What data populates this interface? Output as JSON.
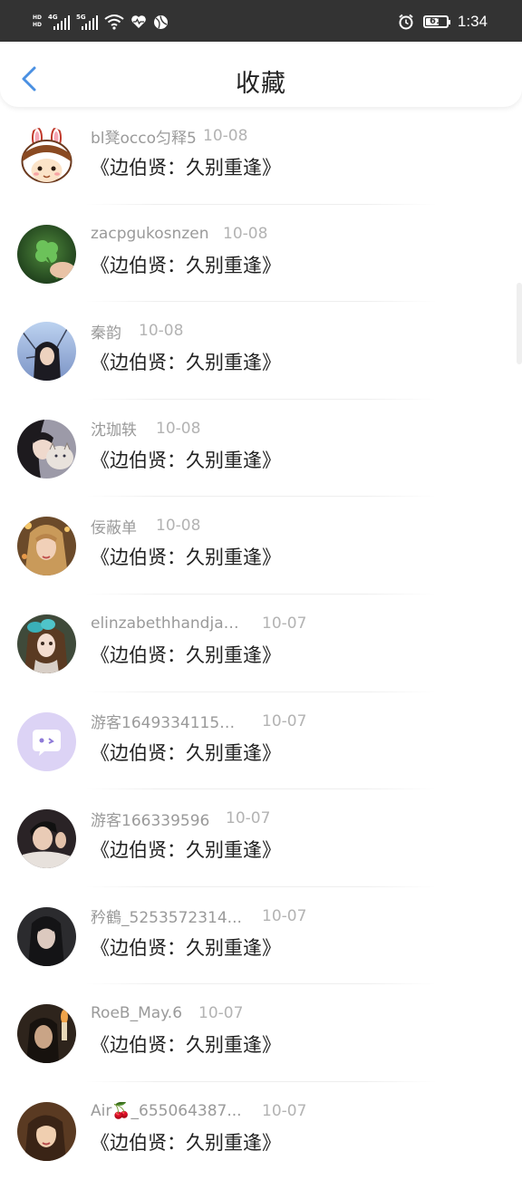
{
  "status_bar": {
    "hd_top": "HD",
    "hd_bottom": "HD",
    "net1": "4G",
    "net2": "5G",
    "battery": "61",
    "time": "1:34"
  },
  "header": {
    "title": "收藏"
  },
  "items": [
    {
      "name": "bl凳occo匀释5",
      "date": "10-08",
      "work": "《边伯贤：久别重逢》",
      "avatar": "bunny"
    },
    {
      "name": "zacpgukosnzen",
      "date": "10-08",
      "work": "《边伯贤：久别重逢》",
      "avatar": "clover"
    },
    {
      "name": "秦韵",
      "date": "10-08",
      "work": "《边伯贤：久别重逢》",
      "avatar": "photo-sky"
    },
    {
      "name": "沈珈轶",
      "date": "10-08",
      "work": "《边伯贤：久别重逢》",
      "avatar": "photo-cat"
    },
    {
      "name": "佞蔽单",
      "date": "10-08",
      "work": "《边伯贤：久别重逢》",
      "avatar": "photo-gold"
    },
    {
      "name": "elinzabethhandjam...",
      "date": "10-07",
      "work": "《边伯贤：久别重逢》",
      "avatar": "photo-doll"
    },
    {
      "name": "游客16493341154...",
      "date": "10-07",
      "work": "《边伯贤：久别重逢》",
      "avatar": "default-chat"
    },
    {
      "name": "游客166339596",
      "date": "10-07",
      "work": "《边伯贤：久别重逢》",
      "avatar": "photo-man"
    },
    {
      "name": "矜鶴_5253572314...",
      "date": "10-07",
      "work": "《边伯贤：久别重逢》",
      "avatar": "photo-dark"
    },
    {
      "name": "RoeB_May.6",
      "date": "10-07",
      "work": "《边伯贤：久别重逢》",
      "avatar": "photo-candle"
    },
    {
      "name": "Air🍒_655064387...",
      "date": "10-07",
      "work": "《边伯贤：久别重逢》",
      "avatar": "photo-warm"
    }
  ],
  "colors": {
    "accent": "#4a90e2",
    "status_bg": "#333333",
    "meta_text": "#9a9a9a",
    "title_text": "#222222"
  }
}
